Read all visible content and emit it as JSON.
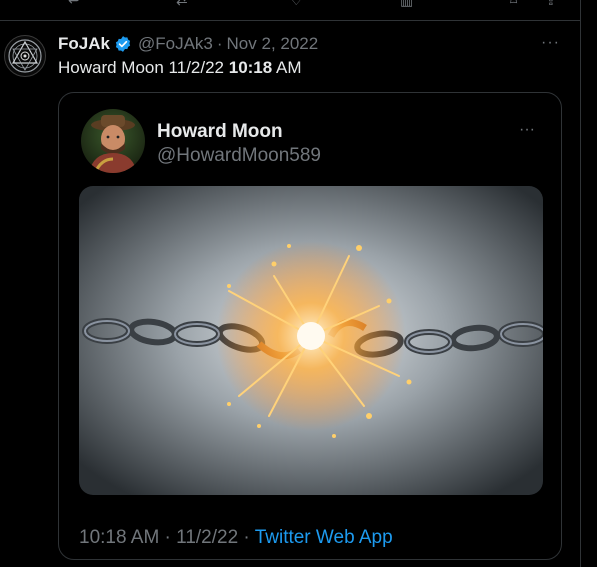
{
  "tweet": {
    "author": {
      "name": "FoJAk",
      "handle": "@FoJAk3",
      "verified": true,
      "avatar_icon": "occult-sigil-icon"
    },
    "separator": "·",
    "date": "Nov 2, 2022",
    "text_prefix": "Howard Moon  11/2/22 ",
    "text_time": "10:18",
    "text_suffix": " AM",
    "more_label": "···"
  },
  "quoted": {
    "name": "Howard Moon",
    "handle": "@HowardMoon589",
    "more_label": "···",
    "media": {
      "description_icon": "broken-chain-image"
    },
    "footer_time": "10:18 AM · 11/2/22 · ",
    "footer_app": "Twitter Web App"
  },
  "colors": {
    "accent": "#1d9bf0",
    "muted": "#71767b",
    "text": "#e7e9ea",
    "border": "#2f3336"
  }
}
